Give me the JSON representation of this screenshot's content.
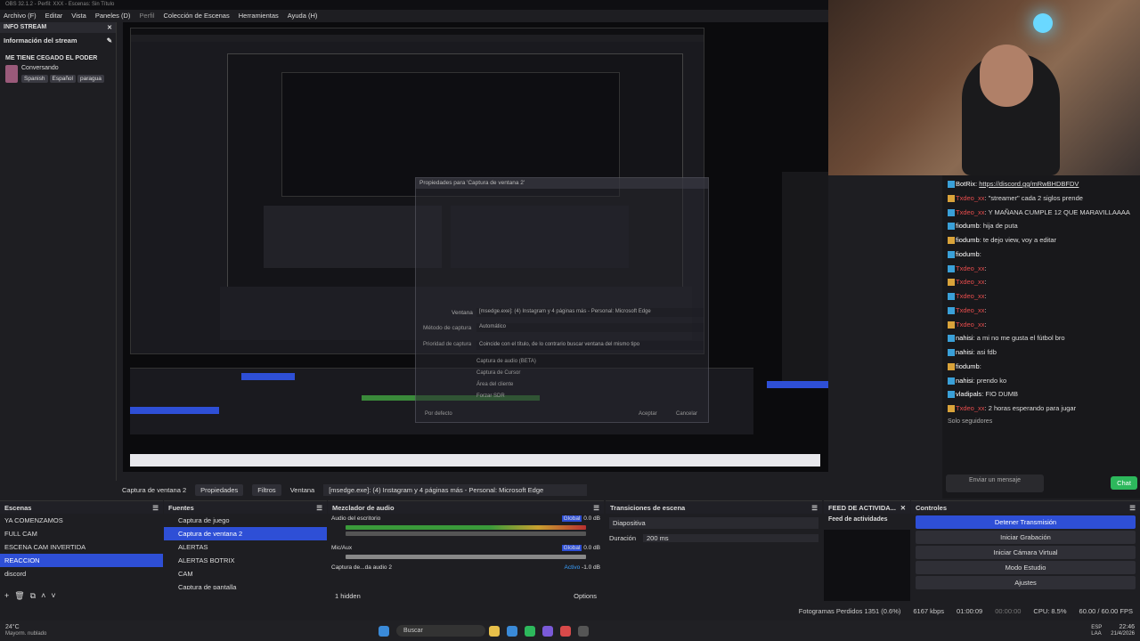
{
  "window": {
    "title": "OBS 32.1.2 - Perfil: XXX - Escenas: Sin Título"
  },
  "menu": [
    "Archivo (F)",
    "Editar",
    "Vista",
    "Paneles (D)",
    "Perfil",
    "Colección de Escenas",
    "Herramientas",
    "Ayuda (H)"
  ],
  "info_stream": {
    "dock_title": "INFO STREAM",
    "header": "Información del stream",
    "title": "ME TIENE CEGADO EL PODER",
    "category": "Conversando",
    "tags": [
      "Spanish",
      "Español",
      "paragua"
    ]
  },
  "preview_dialog": {
    "title": "Propiedades para 'Captura de ventana 2'",
    "ventana_label": "Ventana",
    "ventana_value": "[msedge.exe]: (4) Instagram y 4 páginas más - Personal: Microsoft Edge",
    "method_label": "Método de captura",
    "method_value": "Automático",
    "priority_label": "Prioridad de captura",
    "priority_value": "Coincide con el título, de lo contrario buscar ventana del mismo tipo",
    "options": [
      "Captura de audio (BETA)",
      "Captura de Cursor",
      "Área del cliente",
      "Forzar SDR"
    ],
    "defaults": "Por defecto",
    "accept": "Aceptar",
    "cancel": "Cancelar"
  },
  "stream_chat": {
    "messages": [
      {
        "name": "BotRix",
        "text": "https://discord.gg/mRwBHDBFDV",
        "color": "white"
      },
      {
        "name": "Txdeo_xx",
        "text": "\"streamer\" cada 2 siglos prende",
        "color": "red"
      },
      {
        "name": "Txdeo_xx",
        "text": "Y MAÑANA CUMPLE 12 QUE MARAVILLAAAA",
        "color": "red"
      },
      {
        "name": "fiodumb",
        "text": "hija de puta",
        "color": "white"
      },
      {
        "name": "fiodumb",
        "text": "te dejo view, voy a editar",
        "color": "white"
      },
      {
        "name": "fiodumb",
        "text": "",
        "color": "white"
      },
      {
        "name": "Txdeo_xx",
        "text": "",
        "color": "red"
      },
      {
        "name": "Txdeo_xx",
        "text": "",
        "color": "red"
      },
      {
        "name": "Txdeo_xx",
        "text": "",
        "color": "red"
      },
      {
        "name": "Txdeo_xx",
        "text": "",
        "color": "red"
      },
      {
        "name": "Txdeo_xx",
        "text": "",
        "color": "red"
      },
      {
        "name": "nahisi",
        "text": "a mi no me gusta el fútbol bro",
        "color": "white"
      },
      {
        "name": "nahisi",
        "text": "asi fdb",
        "color": "white"
      },
      {
        "name": "fiodumb",
        "text": "",
        "color": "white"
      },
      {
        "name": "nahisi",
        "text": "prendo ko",
        "color": "white"
      },
      {
        "name": "vladipals",
        "text": "FIO DUMB",
        "color": "white"
      },
      {
        "name": "Txdeo_xx",
        "text": "2 horas esperando para jugar",
        "color": "red"
      }
    ],
    "followers_only": "Solo seguidores",
    "input_placeholder": "Enviar un mensaje",
    "chat_button": "Chat"
  },
  "source_bar": {
    "source": "Captura de ventana 2",
    "properties": "Propiedades",
    "filters": "Filtros",
    "window_label": "Ventana",
    "window_value": "[msedge.exe]: (4) Instagram y 4 páginas más - Personal: Microsoft Edge"
  },
  "scenes": {
    "title": "Escenas",
    "items": [
      "YA COMENZAMOS",
      "FULL CAM",
      "ESCENA CAM INVERTIDA",
      "REACCION",
      "discord"
    ],
    "selected": 3
  },
  "sources": {
    "title": "Fuentes",
    "items": [
      "Captura de juego",
      "Captura de ventana 2",
      "ALERTAS",
      "ALERTAS BOTRIX",
      "CAM",
      "Captura de pantalla"
    ],
    "selected": 1
  },
  "mixer": {
    "title": "Mezclador de audio",
    "tracks": [
      {
        "name": "Audio del escritorio",
        "tag": "Global",
        "db": "0.0 dB"
      },
      {
        "name": "Mic/Aux",
        "tag": "Global",
        "db": "0.0 dB"
      },
      {
        "name": "Captura de...da audio 2",
        "tag": "Activo",
        "db": "-1.0 dB"
      }
    ],
    "hidden": "1 hidden",
    "options": "Options"
  },
  "transitions": {
    "title": "Transiciones de escena",
    "type": "Diapositiva",
    "duration_label": "Duración",
    "duration_value": "200 ms"
  },
  "activity": {
    "title": "FEED DE ACTIVIDA...",
    "header": "Feed de actividades"
  },
  "controls": {
    "title": "Controles",
    "buttons": [
      "Detener Transmisión",
      "Iniciar Grabación",
      "Iniciar Cámara Virtual",
      "Modo Estudio",
      "Ajustes"
    ]
  },
  "status": {
    "dropped": "Fotogramas Perdidos 1351 (0.6%)",
    "bitrate": "6167 kbps",
    "stream_time": "01:00:09",
    "rec_time": "00:00:00",
    "cpu": "CPU: 8.5%",
    "fps": "60.00 / 60.00 FPS"
  },
  "taskbar": {
    "weather_temp": "24°C",
    "weather_desc": "Mayorm. nublado",
    "search": "Buscar",
    "lang1": "ESP",
    "lang2": "LAA",
    "time": "22:46",
    "date": "21/4/2026"
  }
}
